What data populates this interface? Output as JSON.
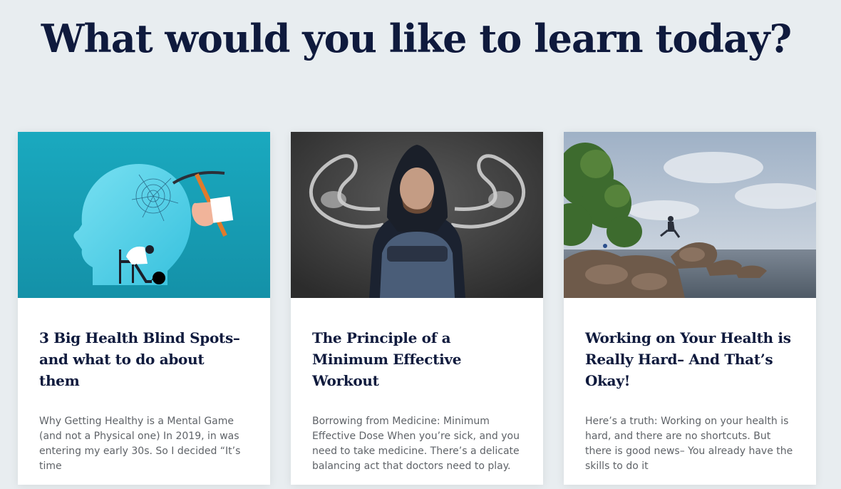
{
  "header": {
    "title": "What would you like to learn today?"
  },
  "cards": [
    {
      "title": "3 Big Health Blind Spots– and what to do about them",
      "excerpt": "Why Getting Healthy is a Mental Game (and not a Physical one) In 2019, in was entering my early 30s. So I decided “It’s time",
      "image_icon": "head-with-pickaxe-illustration"
    },
    {
      "title": "The Principle of a Minimum Effective Workout",
      "excerpt": "Borrowing from Medicine: Minimum Effective Dose When you’re sick, and you need to take medicine. There’s a delicate balancing act that doctors need to play.",
      "image_icon": "hooded-man-chalk-muscles-photo"
    },
    {
      "title": "Working on Your Health is Really Hard– And That’s Okay!",
      "excerpt": "Here’s a truth: Working on your health is hard, and there are no shortcuts. But there is good news– You already have the skills to do it",
      "image_icon": "rocky-shore-jumping-photo"
    }
  ],
  "colors": {
    "background": "#e8edf0",
    "title": "#0f1a3d",
    "excerpt": "#5f6368",
    "card": "#ffffff"
  }
}
